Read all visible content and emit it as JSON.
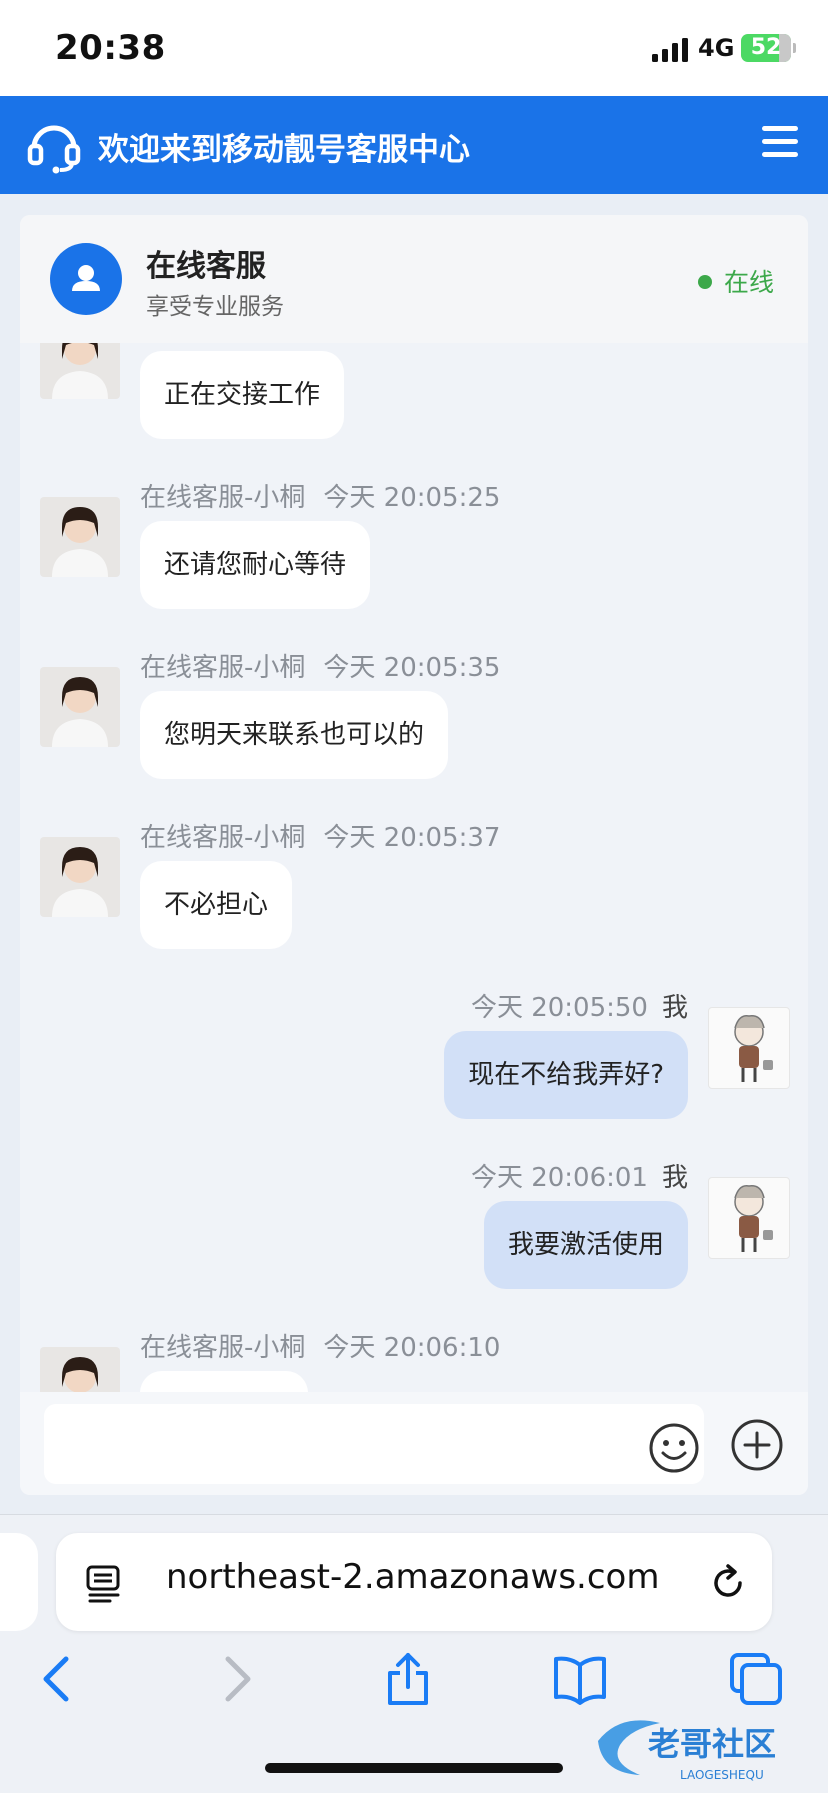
{
  "status_bar": {
    "time": "20:38",
    "network": "4G",
    "battery": "52"
  },
  "header": {
    "title": "欢迎来到移动靓号客服中心",
    "icon": "headset-icon",
    "menu_icon": "hamburger-menu-icon"
  },
  "chat": {
    "agent": {
      "name": "在线客服",
      "subtitle": "享受专业服务",
      "status": "在线"
    },
    "messages": [
      {
        "from": "agent",
        "sender": "",
        "time": "",
        "text": "正在交接工作"
      },
      {
        "from": "agent",
        "sender": "在线客服-小桐",
        "time": "今天 20:05:25",
        "text": "还请您耐心等待"
      },
      {
        "from": "agent",
        "sender": "在线客服-小桐",
        "time": "今天 20:05:35",
        "text": "您明天来联系也可以的"
      },
      {
        "from": "agent",
        "sender": "在线客服-小桐",
        "time": "今天 20:05:37",
        "text": "不必担心"
      },
      {
        "from": "me",
        "sender": "我",
        "time": "今天 20:05:50",
        "text": "现在不给我弄好?"
      },
      {
        "from": "me",
        "sender": "我",
        "time": "今天 20:06:01",
        "text": "我要激活使用"
      },
      {
        "from": "agent",
        "sender": "在线客服-小桐",
        "time": "今天 20:06:10",
        "text": ""
      }
    ],
    "input": {
      "placeholder": "",
      "emoji_icon": "emoji-icon",
      "add_icon": "plus-circle-icon"
    }
  },
  "browser": {
    "url": "northeast-2.amazonaws.com",
    "icons": [
      "reader-icon",
      "reload-icon",
      "back-icon",
      "forward-icon",
      "share-icon",
      "bookmarks-icon",
      "tabs-icon"
    ]
  },
  "watermark": {
    "text": "老哥社区",
    "subtext": "LAOGESHEQU"
  },
  "colors": {
    "brand": "#1a73e8",
    "online": "#3ca84a",
    "my_bubble": "#d2e0f7"
  }
}
